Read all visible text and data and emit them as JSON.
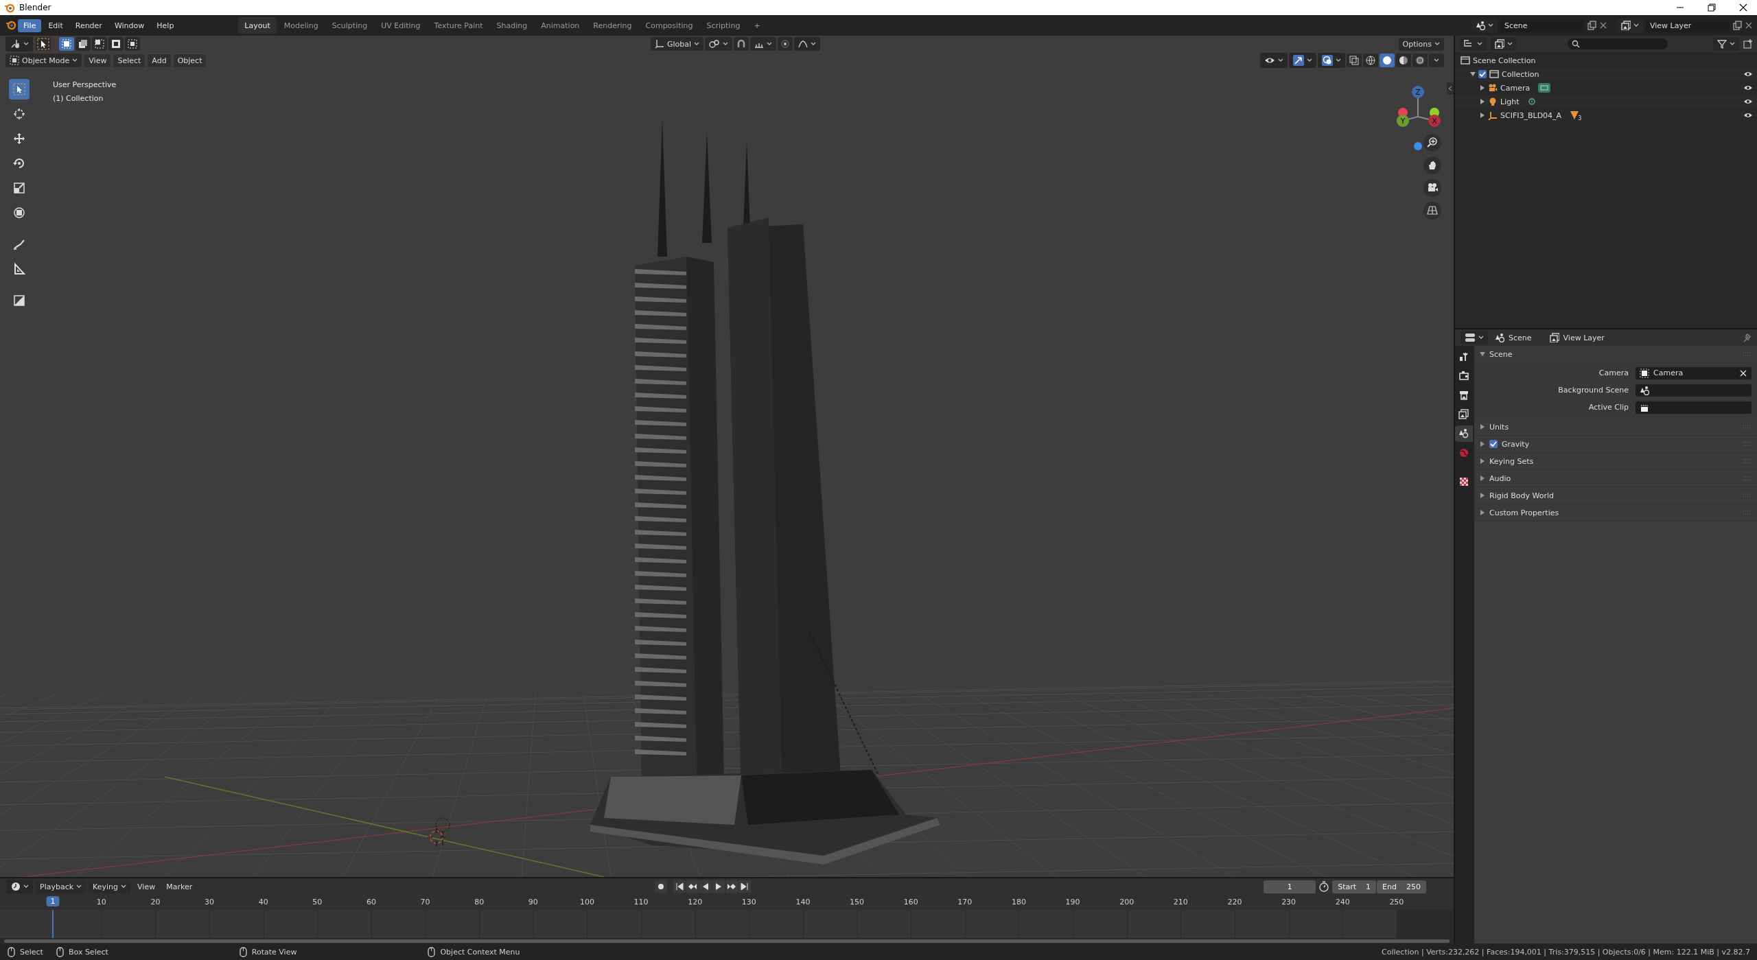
{
  "window": {
    "title": "Blender"
  },
  "menu": [
    {
      "label": "File",
      "selected": true
    },
    {
      "label": "Edit",
      "selected": false
    },
    {
      "label": "Render",
      "selected": false
    },
    {
      "label": "Window",
      "selected": false
    },
    {
      "label": "Help",
      "selected": false
    }
  ],
  "workspaces": [
    {
      "label": "Layout",
      "selected": true
    },
    {
      "label": "Modeling",
      "selected": false
    },
    {
      "label": "Sculpting",
      "selected": false
    },
    {
      "label": "UV Editing",
      "selected": false
    },
    {
      "label": "Texture Paint",
      "selected": false
    },
    {
      "label": "Shading",
      "selected": false
    },
    {
      "label": "Animation",
      "selected": false
    },
    {
      "label": "Rendering",
      "selected": false
    },
    {
      "label": "Compositing",
      "selected": false
    },
    {
      "label": "Scripting",
      "selected": false
    },
    {
      "label": "+",
      "selected": false
    }
  ],
  "scene_selector": {
    "value": "Scene"
  },
  "view_layer_selector": {
    "value": "View Layer"
  },
  "tool_header": {
    "orientation": "Global",
    "options": "Options"
  },
  "viewport_header": {
    "mode": "Object Mode",
    "menus": [
      "View",
      "Select",
      "Add",
      "Object"
    ]
  },
  "viewport": {
    "overlay_lines": [
      "User Perspective",
      "(1) Collection"
    ],
    "axes": [
      "Z",
      "Y",
      "X"
    ]
  },
  "toolbar": [
    {
      "kind": "select",
      "selected": true
    },
    {
      "kind": "cursor",
      "selected": false
    },
    {
      "kind": "move",
      "selected": false
    },
    {
      "kind": "rotate",
      "selected": false
    },
    {
      "kind": "scale",
      "selected": false
    },
    {
      "kind": "transform",
      "selected": false
    },
    {
      "kind": "annotate",
      "selected": false
    },
    {
      "kind": "measure",
      "selected": false
    },
    {
      "kind": "add_cube",
      "selected": false
    }
  ],
  "outliner": {
    "items": [
      {
        "label": "Scene Collection",
        "kind": "scene_collection",
        "children": [
          {
            "label": "Collection",
            "kind": "collection",
            "checked": true,
            "expanded": true,
            "children": [
              {
                "label": "Camera",
                "kind": "camera",
                "expanded": false
              },
              {
                "label": "Light",
                "kind": "light",
                "expanded": false
              },
              {
                "label": "SCIFI3_BLD04_A",
                "kind": "mesh",
                "expanded": false,
                "badge": "3"
              }
            ]
          }
        ]
      }
    ]
  },
  "properties": {
    "tabs": [
      {
        "kind": "tool",
        "selected": false
      },
      {
        "kind": "render",
        "selected": false
      },
      {
        "kind": "output",
        "selected": false
      },
      {
        "kind": "view_layer",
        "selected": false
      },
      {
        "kind": "scene",
        "selected": true
      },
      {
        "kind": "world",
        "selected": false
      },
      {
        "kind": "texture",
        "selected": false
      }
    ],
    "breadcrumbs": [
      "Scene",
      "View Layer"
    ],
    "panels": [
      {
        "title": "Scene",
        "expanded": true,
        "fields": [
          {
            "label": "Camera",
            "kind": "camera",
            "value": "Camera"
          },
          {
            "label": "Background Scene",
            "kind": "scene"
          },
          {
            "label": "Active Clip",
            "kind": "clip"
          }
        ]
      },
      {
        "title": "Units",
        "expanded": false
      },
      {
        "title": "Gravity",
        "expanded": false,
        "checked": true
      },
      {
        "title": "Keying Sets",
        "expanded": false
      },
      {
        "title": "Audio",
        "expanded": false
      },
      {
        "title": "Rigid Body World",
        "expanded": false
      },
      {
        "title": "Custom Properties",
        "expanded": false
      }
    ]
  },
  "timeline": {
    "menus": [
      "Playback",
      "Keying",
      "View",
      "Marker"
    ],
    "current_frame": "1",
    "start_label": "Start",
    "start": "1",
    "end_label": "End",
    "end": "250",
    "ruler": [
      {
        "label": "1",
        "selected": true
      },
      {
        "label": "10",
        "selected": false
      },
      {
        "label": "20",
        "selected": false
      },
      {
        "label": "30",
        "selected": false
      },
      {
        "label": "40",
        "selected": false
      },
      {
        "label": "50",
        "selected": false
      },
      {
        "label": "60",
        "selected": false
      },
      {
        "label": "70",
        "selected": false
      },
      {
        "label": "80",
        "selected": false
      },
      {
        "label": "90",
        "selected": false
      },
      {
        "label": "100",
        "selected": false
      },
      {
        "label": "110",
        "selected": false
      },
      {
        "label": "120",
        "selected": false
      },
      {
        "label": "130",
        "selected": false
      },
      {
        "label": "140",
        "selected": false
      },
      {
        "label": "150",
        "selected": false
      },
      {
        "label": "160",
        "selected": false
      },
      {
        "label": "170",
        "selected": false
      },
      {
        "label": "180",
        "selected": false
      },
      {
        "label": "190",
        "selected": false
      },
      {
        "label": "200",
        "selected": false
      },
      {
        "label": "210",
        "selected": false
      },
      {
        "label": "220",
        "selected": false
      },
      {
        "label": "230",
        "selected": false
      },
      {
        "label": "240",
        "selected": false
      },
      {
        "label": "250",
        "selected": false
      }
    ]
  },
  "status_bar": {
    "hints": [
      "Select",
      "Box Select",
      "Rotate View",
      "Object Context Menu"
    ],
    "stats": "Collection | Verts:232,262 | Faces:194,001 | Tris:379,515 | Objects:0/6 | Mem: 122.1 MiB | v2.82.7"
  }
}
